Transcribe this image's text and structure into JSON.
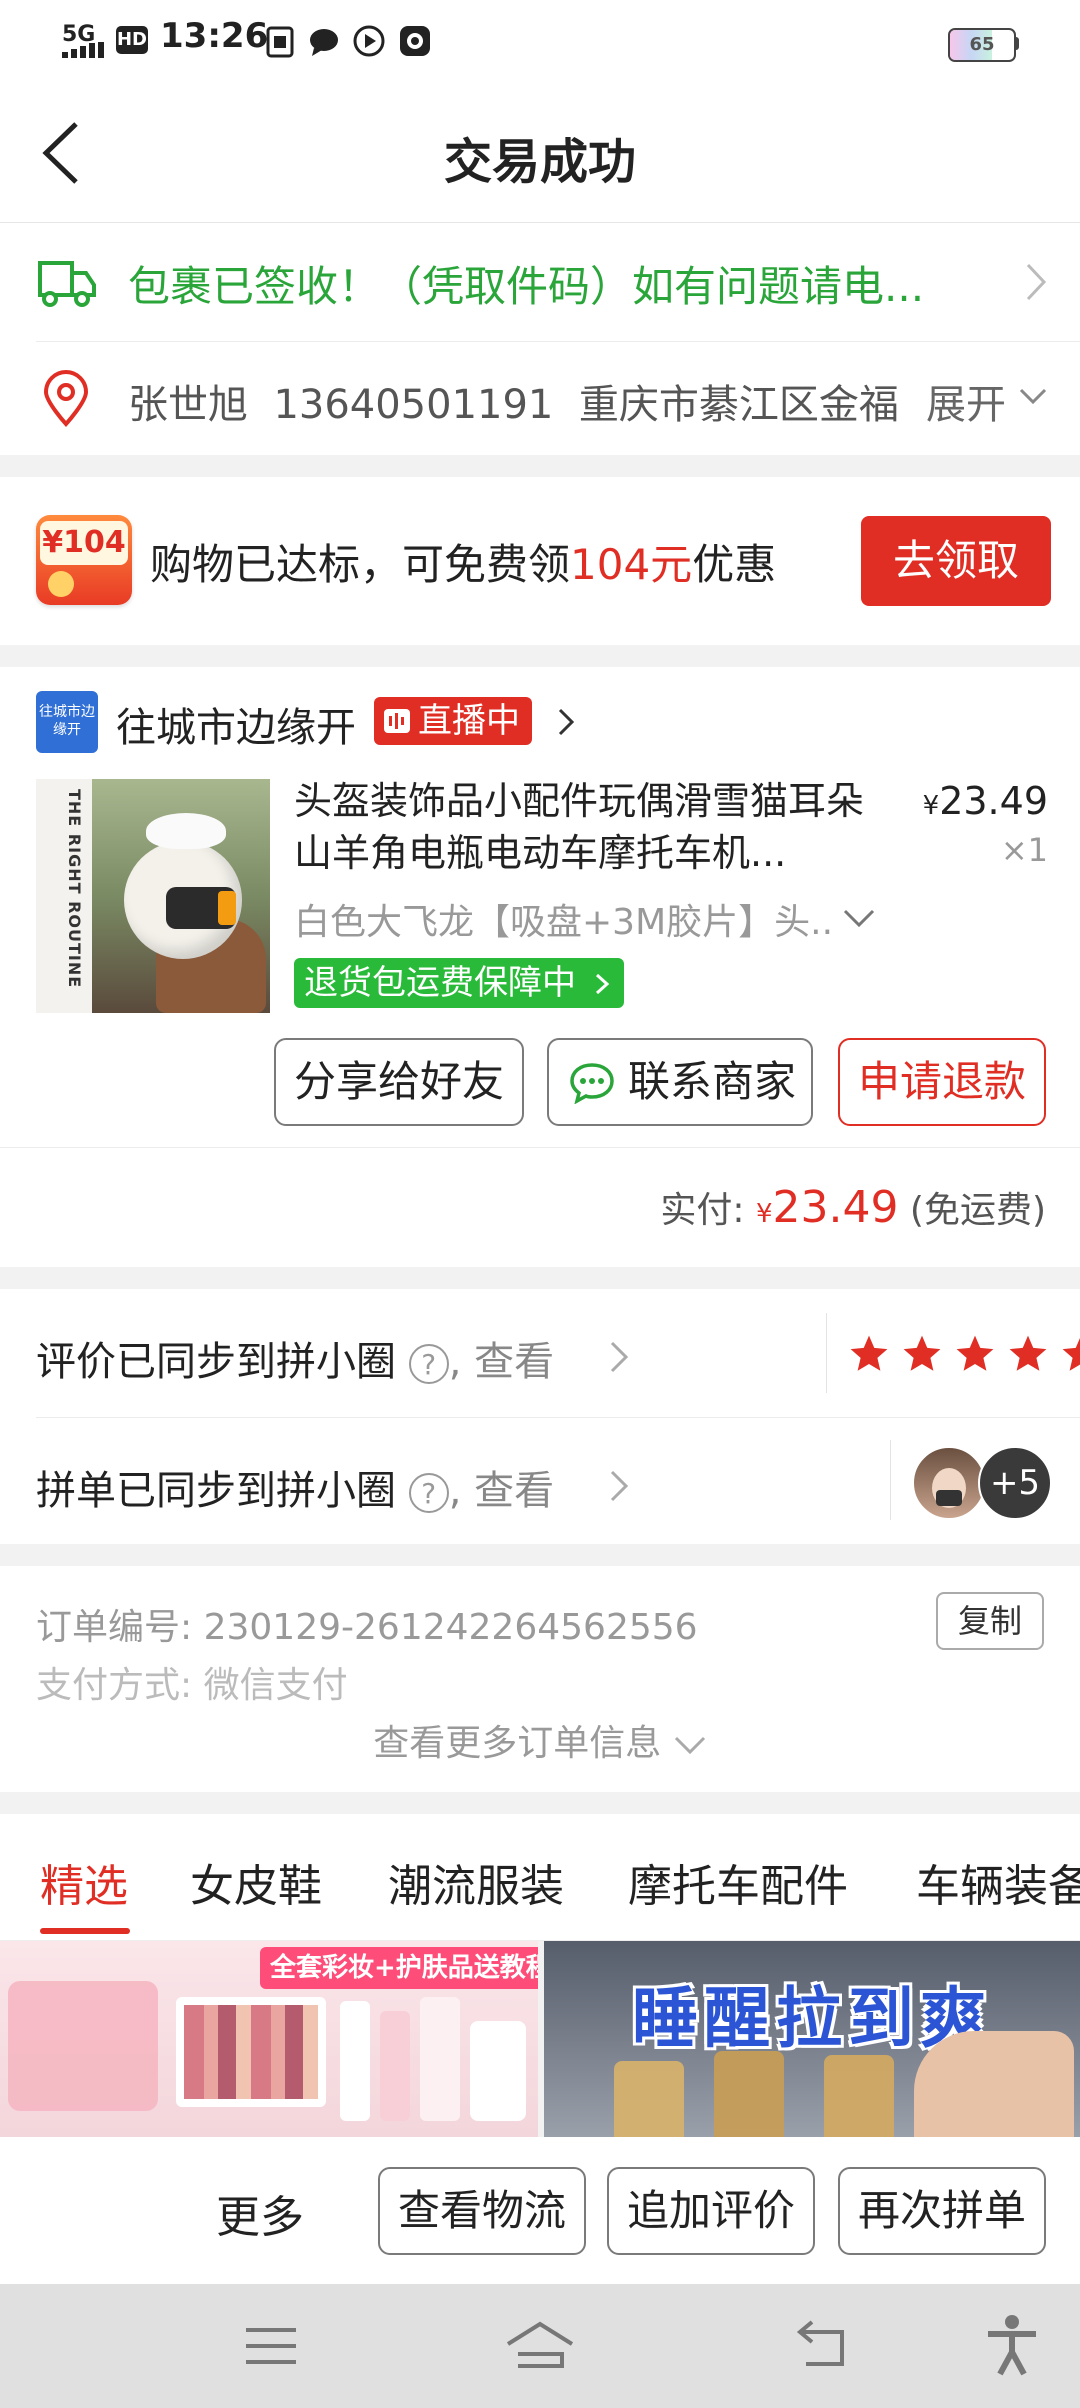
{
  "status_bar": {
    "signal": "5G",
    "hd": "HD",
    "time": "13:26",
    "battery": "65",
    "battery_level": 0.65
  },
  "header": {
    "title": "交易成功"
  },
  "delivery": {
    "text": "包裹已签收！（凭取件码）如有问题请电..."
  },
  "address": {
    "name": "张世旭",
    "phone": "13640501191",
    "address": "重庆市綦江区金福",
    "expand": "展开"
  },
  "coupon": {
    "badge": "¥104",
    "text_prefix": "购物已达标，可免费领",
    "amount": "104元",
    "text_suffix": "优惠",
    "button": "去领取"
  },
  "shop": {
    "logo_text": "往城市边缘开",
    "name": "往城市边缘开",
    "live_badge": "直播中"
  },
  "product": {
    "image_text": "THE RIGHT ROUTINE",
    "title": "头盔装饰品小配件玩偶滑雪猫耳朵山羊角电瓶电动车摩托车机...",
    "price_symbol": "¥",
    "price": "23.49",
    "quantity": "×1",
    "spec": "白色大飞龙【吸盘+3M胶片】头...",
    "guarantee": "退货包运费保障中"
  },
  "actions": {
    "share": "分享给好友",
    "contact": "联系商家",
    "refund": "申请退款"
  },
  "payment": {
    "label": "实付:",
    "symbol": "¥",
    "amount": "23.49",
    "note": "(免运费)"
  },
  "review_sync": {
    "text": "评价已同步到拼小圈",
    "view": ", 查看",
    "stars": 5
  },
  "group_sync": {
    "text": "拼单已同步到拼小圈",
    "view": ", 查看",
    "extra_count": "+5"
  },
  "order_info": {
    "number_label": "订单编号:",
    "number": "230129-261242264562556",
    "copy": "复制",
    "pay_label": "支付方式:",
    "pay_method": "微信支付",
    "more": "查看更多订单信息"
  },
  "tabs": [
    {
      "label": "精选",
      "active": true
    },
    {
      "label": "女皮鞋"
    },
    {
      "label": "潮流服装"
    },
    {
      "label": "摩托车配件"
    },
    {
      "label": "车辆装备"
    }
  ],
  "recommend": {
    "banner_left": "全套彩妆+护肤品送教程",
    "banner_right": "睡醒拉到爽"
  },
  "bottom_bar": {
    "more": "更多",
    "logistics": "查看物流",
    "add_review": "追加评价",
    "reorder": "再次拼单"
  },
  "colors": {
    "accent_red": "#e02e24",
    "green": "#2aa53a",
    "star": "#e02e24"
  }
}
